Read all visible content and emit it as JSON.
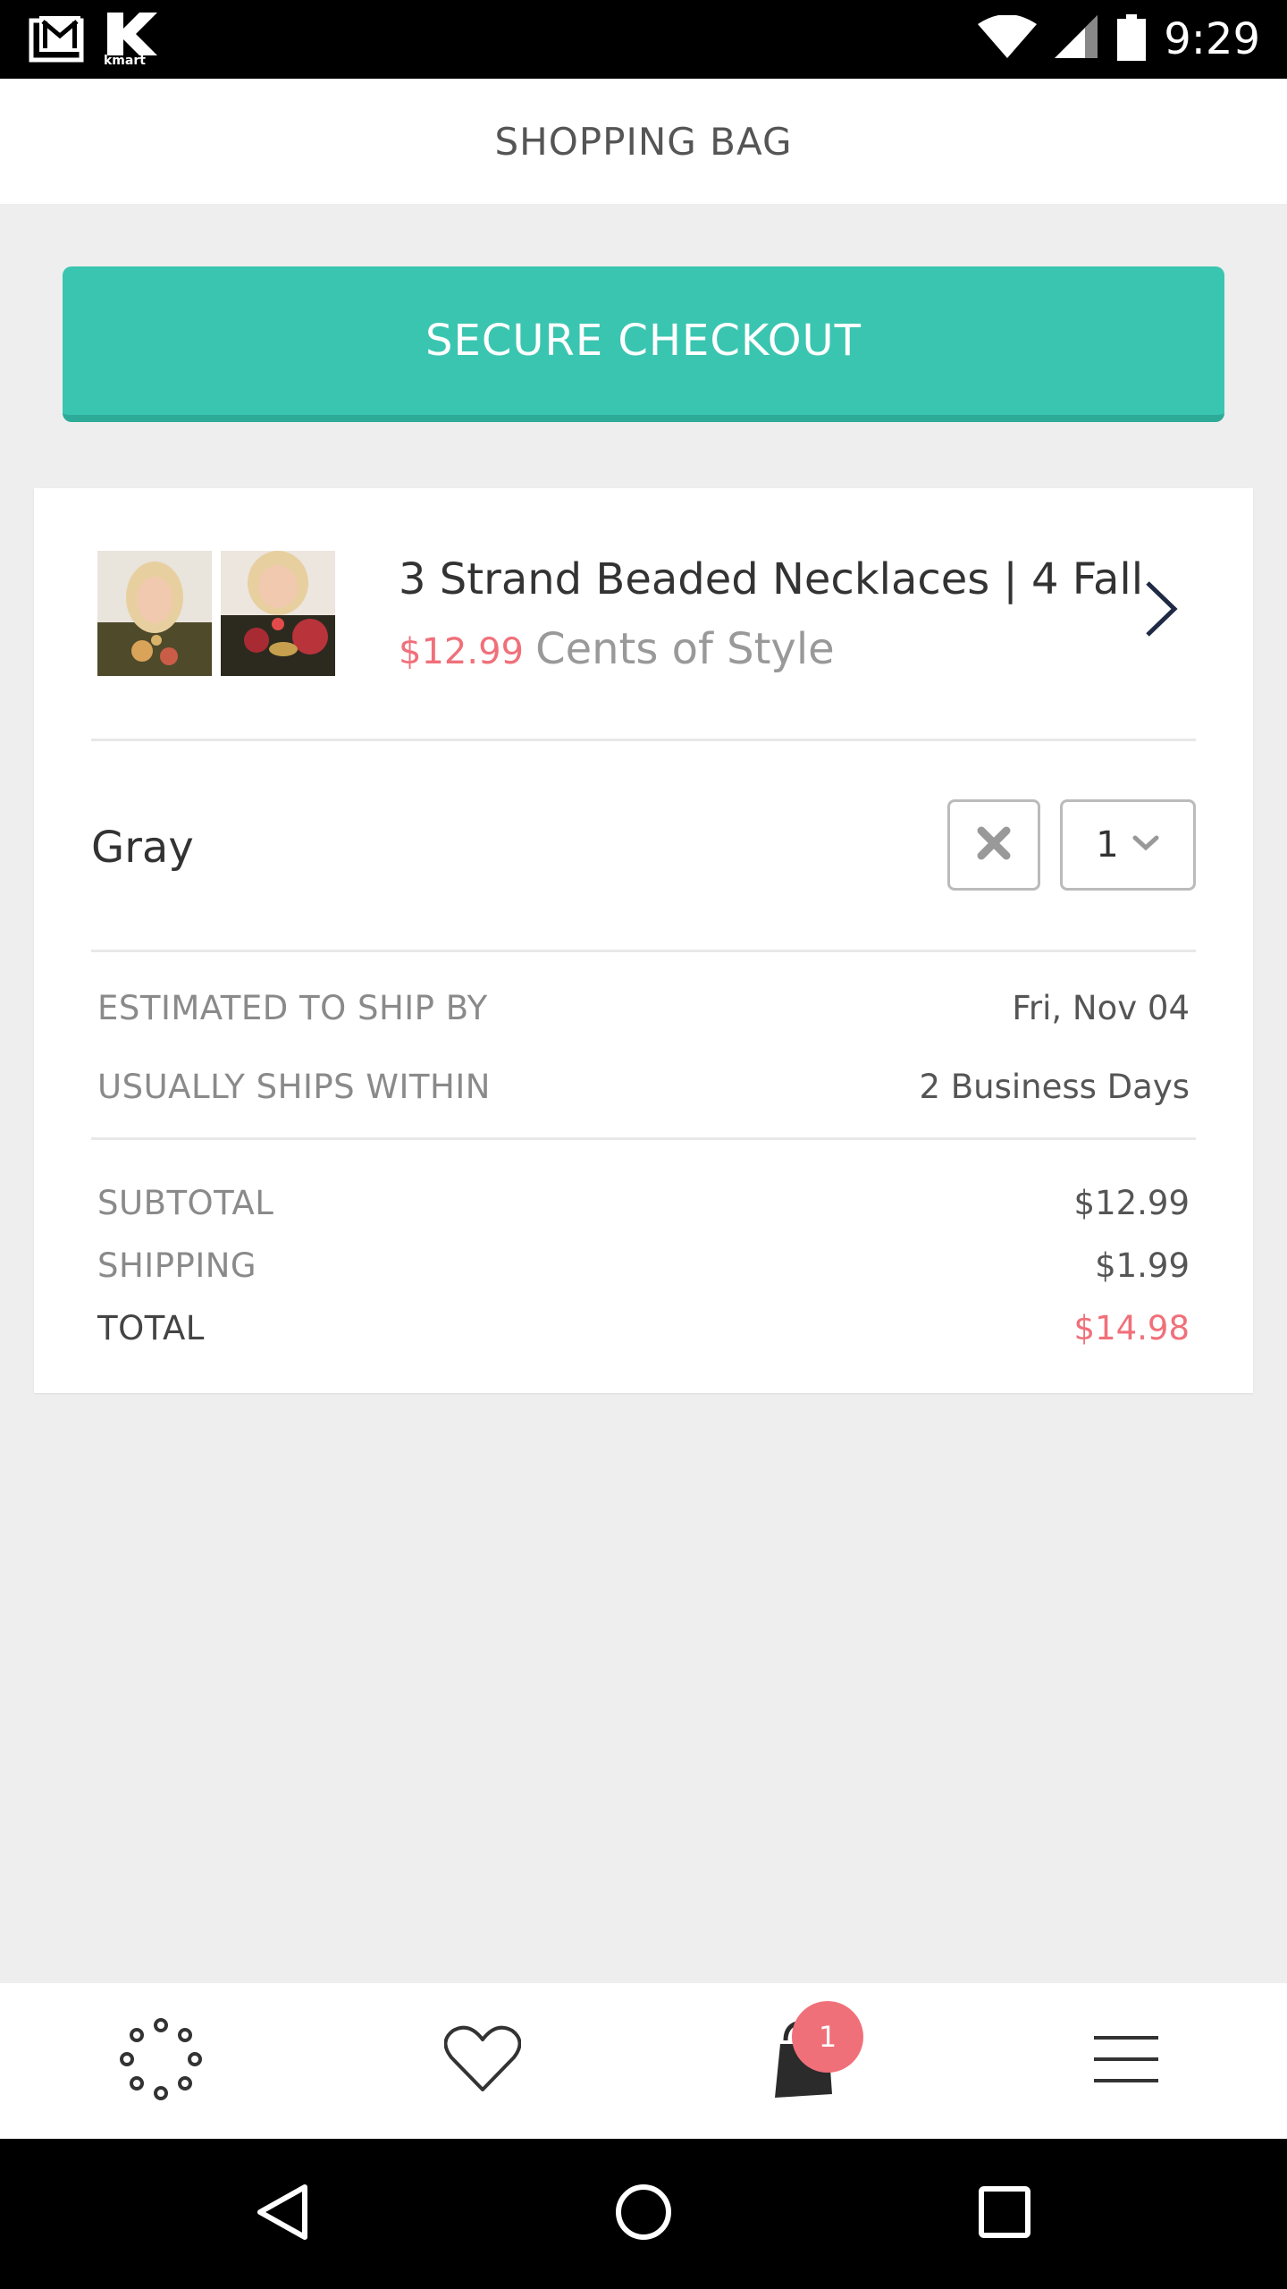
{
  "status_bar": {
    "time": "9:29",
    "left_icons": [
      "gmail-icon",
      "kmart-icon"
    ],
    "kmart_text": "kmart",
    "right_icons": [
      "wifi-icon",
      "signal-icon",
      "battery-icon"
    ]
  },
  "header": {
    "title": "SHOPPING BAG"
  },
  "checkout": {
    "label": "SECURE CHECKOUT",
    "color": "#3ac5b0"
  },
  "cart": {
    "item": {
      "title": "3 Strand Beaded Necklaces | 4 Fall",
      "price": "$12.99",
      "brand": "Cents of Style",
      "variant": "Gray",
      "quantity": "1"
    },
    "shipping_info": {
      "estimated_label": "ESTIMATED TO SHIP BY",
      "estimated_value": "Fri, Nov 04",
      "ships_within_label": "USUALLY SHIPS WITHIN",
      "ships_within_value": "2 Business Days"
    },
    "summary": {
      "subtotal_label": "SUBTOTAL",
      "subtotal_value": "$12.99",
      "shipping_label": "SHIPPING",
      "shipping_value": "$1.99",
      "total_label": "TOTAL",
      "total_value": "$14.98"
    }
  },
  "tab_bar": {
    "tabs": [
      "dots-circle-icon",
      "heart-icon",
      "shopping-bag-icon",
      "menu-icon"
    ],
    "bag_count": "1",
    "accent_color": "#f0707a"
  },
  "nav_bar": {
    "buttons": [
      "back-icon",
      "home-icon",
      "recents-icon"
    ]
  }
}
